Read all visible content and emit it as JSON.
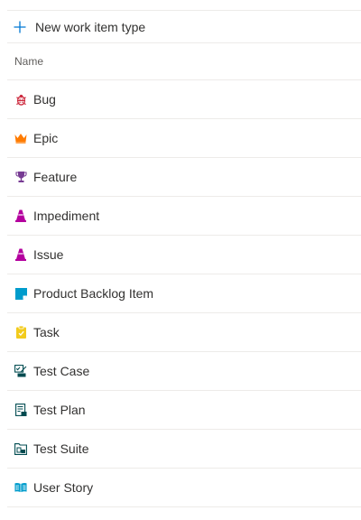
{
  "toolbar": {
    "new_label": "New work item type"
  },
  "table": {
    "header_name": "Name",
    "items": [
      {
        "label": "Bug",
        "icon": "bug-icon",
        "color": "#cc293d"
      },
      {
        "label": "Epic",
        "icon": "crown-icon",
        "color": "#ff7b00"
      },
      {
        "label": "Feature",
        "icon": "trophy-icon",
        "color": "#773b93"
      },
      {
        "label": "Impediment",
        "icon": "traffic-cone-icon",
        "color": "#b4009e"
      },
      {
        "label": "Issue",
        "icon": "traffic-cone-icon",
        "color": "#b4009e"
      },
      {
        "label": "Product Backlog Item",
        "icon": "sticky-note-icon",
        "color": "#009ccc"
      },
      {
        "label": "Task",
        "icon": "clipboard-check-icon",
        "color": "#f2cb1d"
      },
      {
        "label": "Test Case",
        "icon": "test-case-icon",
        "color": "#004b50"
      },
      {
        "label": "Test Plan",
        "icon": "test-plan-icon",
        "color": "#004b50"
      },
      {
        "label": "Test Suite",
        "icon": "test-suite-icon",
        "color": "#004b50"
      },
      {
        "label": "User Story",
        "icon": "book-icon",
        "color": "#009ccc"
      }
    ]
  }
}
